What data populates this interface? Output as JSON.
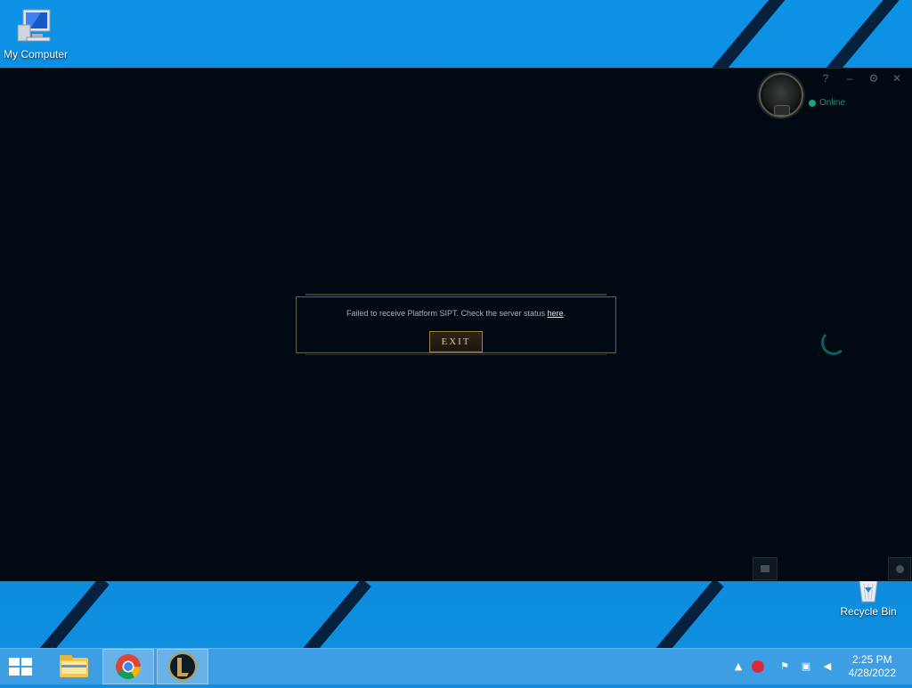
{
  "desktop": {
    "icons": [
      {
        "label": "My Computer"
      },
      {
        "label": "Recycle Bin"
      }
    ]
  },
  "client": {
    "status": "Online",
    "controls": {
      "help": "?",
      "minimize": "–",
      "settings": "⚙",
      "close": "✕"
    },
    "dialog": {
      "message": "Failed to receive Platform SIPT. Check the server status ",
      "link_text": "here",
      "message_end": ".",
      "exit_label": "EXIT"
    }
  },
  "taskbar": {
    "apps": [
      "file-explorer",
      "chrome",
      "league-of-legends"
    ],
    "clock": {
      "time": "2:25 PM",
      "date": "4/28/2022"
    }
  }
}
